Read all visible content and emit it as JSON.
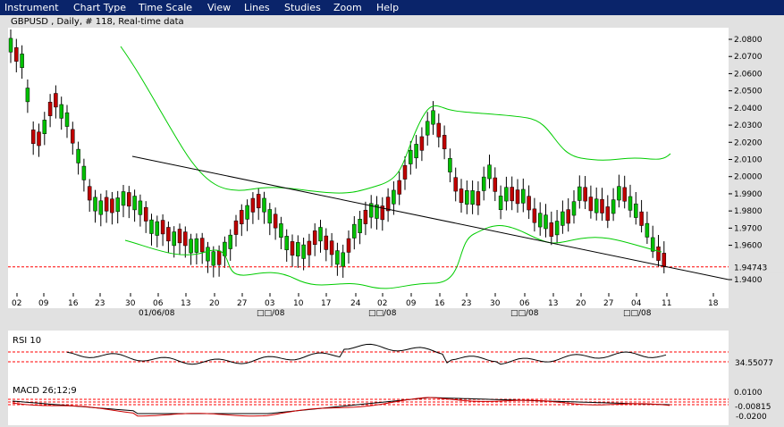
{
  "menu": {
    "items": [
      {
        "name": "menu-instrument",
        "label": "Instrument"
      },
      {
        "name": "menu-chart-type",
        "label": "Chart Type"
      },
      {
        "name": "menu-time-scale",
        "label": "Time Scale"
      },
      {
        "name": "menu-view",
        "label": "View"
      },
      {
        "name": "menu-lines",
        "label": "Lines"
      },
      {
        "name": "menu-studies",
        "label": "Studies"
      },
      {
        "name": "menu-zoom",
        "label": "Zoom"
      },
      {
        "name": "menu-help",
        "label": "Help"
      }
    ]
  },
  "colors": {
    "bull": "#00c000",
    "bear": "#c00000",
    "bands": "#00cc00",
    "trendline": "#000000",
    "level": "#ff0000",
    "macd_signal": "#cc0000",
    "background": "#ffffff",
    "frame": "#e1e1e1"
  },
  "price_panel": {
    "title": "GBPUSD , Daily, # 118, Real-time data",
    "current_price_label": "1.94743",
    "current_price": 1.94743,
    "y_ticks": [
      "2.0800",
      "2.0700",
      "2.0600",
      "2.0500",
      "2.0400",
      "2.0300",
      "2.0200",
      "2.0100",
      "2.0000",
      "1.9900",
      "1.9800",
      "1.9700",
      "1.9600",
      "1.9400"
    ]
  },
  "date_axis": {
    "days": [
      "02",
      "09",
      "16",
      "23",
      "30",
      "06",
      "13",
      "20",
      "27",
      "03",
      "10",
      "17",
      "24",
      "02",
      "09",
      "16",
      "23",
      "30",
      "06",
      "13",
      "20",
      "27",
      "04",
      "11",
      "18"
    ],
    "months": [
      "01/06/08",
      "□□/08",
      "□□/08",
      "□□/08",
      "□□/08"
    ]
  },
  "rsi_panel": {
    "title": "RSI 10",
    "value_label": "34.55077"
  },
  "macd_panel": {
    "title": "MACD 26;12;9",
    "value_label": "-0.00815",
    "y_ticks": [
      "0.0100",
      "-0.0200"
    ]
  },
  "chart_data": {
    "type": "candlestick",
    "title": "GBPUSD , Daily, # 118, Real-time data",
    "ylim": [
      1.935,
      2.085
    ],
    "grid": false,
    "indicators": [
      "Bollinger Bands",
      "Trendline",
      "RSI 10",
      "MACD 26;12;9"
    ]
  }
}
